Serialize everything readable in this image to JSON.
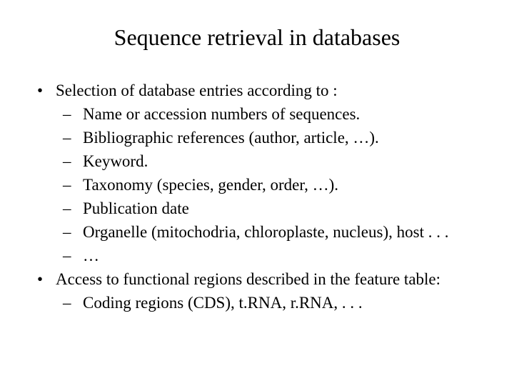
{
  "title": "Sequence retrieval in databases",
  "bullets": {
    "b1": "Selection of database entries according to :",
    "b1_1": "Name or accession numbers of sequences.",
    "b1_2": "Bibliographic references (author, article, …).",
    "b1_3": "Keyword.",
    "b1_4": "Taxonomy (species, gender, order, …).",
    "b1_5": "Publication date",
    "b1_6": "Organelle (mitochodria, chloroplaste, nucleus), host . . .",
    "b1_7": "…",
    "b2": "Access to functional regions described in the feature table:",
    "b2_1": "Coding regions (CDS), t.RNA, r.RNA, . . ."
  }
}
